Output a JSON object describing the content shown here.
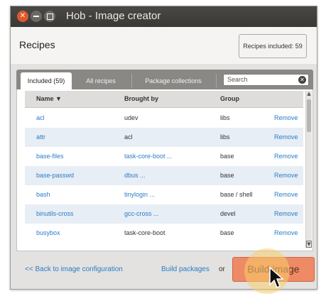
{
  "window": {
    "title": "Hob - Image creator"
  },
  "header": {
    "title": "Recipes",
    "count_label": "Recipes included: 59"
  },
  "tabs": [
    {
      "label": "Included (59)",
      "active": true
    },
    {
      "label": "All recipes",
      "active": false
    },
    {
      "label": "Package collections",
      "active": false
    }
  ],
  "search": {
    "placeholder": "Search"
  },
  "table": {
    "columns": [
      "Name ▼",
      "Brought by",
      "Group",
      ""
    ],
    "rows": [
      {
        "name": "acl",
        "brought_by": "udev",
        "brought_by_link": false,
        "group": "libs",
        "action": "Remove"
      },
      {
        "name": "attr",
        "brought_by": "acl",
        "brought_by_link": false,
        "group": "libs",
        "action": "Remove"
      },
      {
        "name": "base-files",
        "brought_by": "task-core-boot ...",
        "brought_by_link": true,
        "group": "base",
        "action": "Remove"
      },
      {
        "name": "base-passwd",
        "brought_by": "dbus ...",
        "brought_by_link": true,
        "group": "base",
        "action": "Remove"
      },
      {
        "name": "bash",
        "brought_by": "tinylogin ...",
        "brought_by_link": true,
        "group": "base / shell",
        "action": "Remove"
      },
      {
        "name": "binutils-cross",
        "brought_by": "gcc-cross ...",
        "brought_by_link": true,
        "group": "devel",
        "action": "Remove"
      },
      {
        "name": "busybox",
        "brought_by": "task-core-boot",
        "brought_by_link": false,
        "group": "base",
        "action": "Remove"
      }
    ]
  },
  "footer": {
    "back_label": "<< Back to image configuration",
    "build_packages_label": "Build packages",
    "or_label": "or",
    "build_image_label": "Build image"
  },
  "colors": {
    "link": "#2a7cc7",
    "build_button": "#ee8a65",
    "close_button": "#e0582c",
    "row_alt": "#e8eef5"
  }
}
